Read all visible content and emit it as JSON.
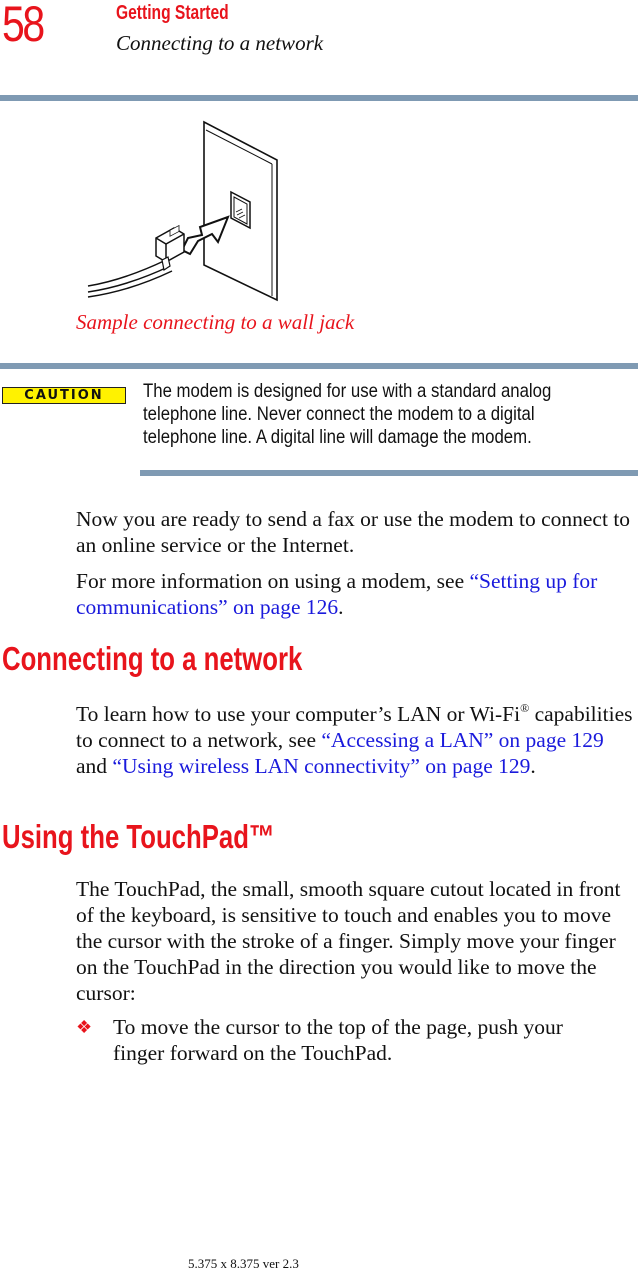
{
  "header": {
    "page_number": "58",
    "chapter_title": "Getting Started",
    "section_title": "Connecting to a network"
  },
  "figure": {
    "icon": "phone-cable-to-wall-jack-illustration",
    "caption": "Sample connecting to a wall jack"
  },
  "caution": {
    "badge": "CAUTION",
    "text": "The modem is designed for use with a standard analog telephone line. Never connect the modem to a digital telephone line. A digital line will damage the modem."
  },
  "paragraphs": {
    "ready": "Now you are ready to send a fax or use the modem to connect to an online service or the Internet.",
    "more_info_prefix": "For more information on using a modem, see ",
    "more_info_link": "“Setting up for communications” on page 126",
    "more_info_suffix": "."
  },
  "network_section": {
    "heading": "Connecting to a network",
    "text_1": "To learn how to use your computer’s LAN or Wi-Fi",
    "registered": "®",
    "text_2": " capabilities to connect to a network, see ",
    "link_1": "“Accessing a LAN” on page 129",
    "text_3": " and ",
    "link_2": "“Using wireless LAN connectivity” on page 129",
    "text_4": "."
  },
  "touchpad_section": {
    "heading": "Using the TouchPad™",
    "intro": "The TouchPad, the small, smooth square cutout located in front of the keyboard, is sensitive to touch and enables you to move the cursor with the stroke of a finger. Simply move your finger on the TouchPad in the direction you would like to move the cursor:",
    "bullets": [
      {
        "icon": "red-diamond-bullet-icon",
        "glyph": "❖",
        "text": "To move the cursor to the top of the page, push your finger forward on the TouchPad."
      }
    ]
  },
  "footer": {
    "text": "5.375 x 8.375 ver 2.3"
  },
  "colors": {
    "accent_red": "#e8141c",
    "link_blue": "#1a1adc",
    "rule_blue_gray": "#7f9ab3",
    "caution_yellow": "#fff200"
  }
}
